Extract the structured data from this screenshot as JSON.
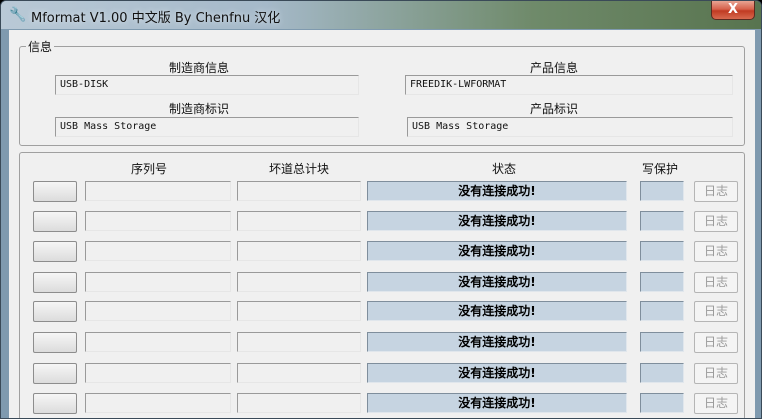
{
  "window": {
    "title": "Mformat V1.00 中文版 By Chenfnu 汉化",
    "close_glyph": "X",
    "app_icon": "wrench-icon"
  },
  "info": {
    "group_title": "信息",
    "vendor_info_label": "制造商信息",
    "vendor_info_value": "USB-DISK",
    "product_info_label": "产品信息",
    "product_info_value": "FREEDIK-LWFORMAT",
    "vendor_id_label": "制造商标识",
    "vendor_id_value": "USB Mass Storage",
    "product_id_label": "产品标识",
    "product_id_value": "USB Mass Storage"
  },
  "ports": {
    "headers": {
      "serial": "序列号",
      "bad_blocks": "坏道总计块",
      "status": "状态",
      "write_protect": "写保护"
    },
    "rows": [
      {
        "status": "没有连接成功!",
        "log": "日志"
      },
      {
        "status": "没有连接成功!",
        "log": "日志"
      },
      {
        "status": "没有连接成功!",
        "log": "日志"
      },
      {
        "status": "没有连接成功!",
        "log": "日志"
      },
      {
        "status": "没有连接成功!",
        "log": "日志"
      },
      {
        "status": "没有连接成功!",
        "log": "日志"
      },
      {
        "status": "没有连接成功!",
        "log": "日志"
      },
      {
        "status": "没有连接成功!",
        "log": "日志"
      }
    ]
  },
  "colors": {
    "status_bg": "#c6d4e1",
    "client_bg": "#f0f0f0",
    "close_button": "#c03a22"
  }
}
